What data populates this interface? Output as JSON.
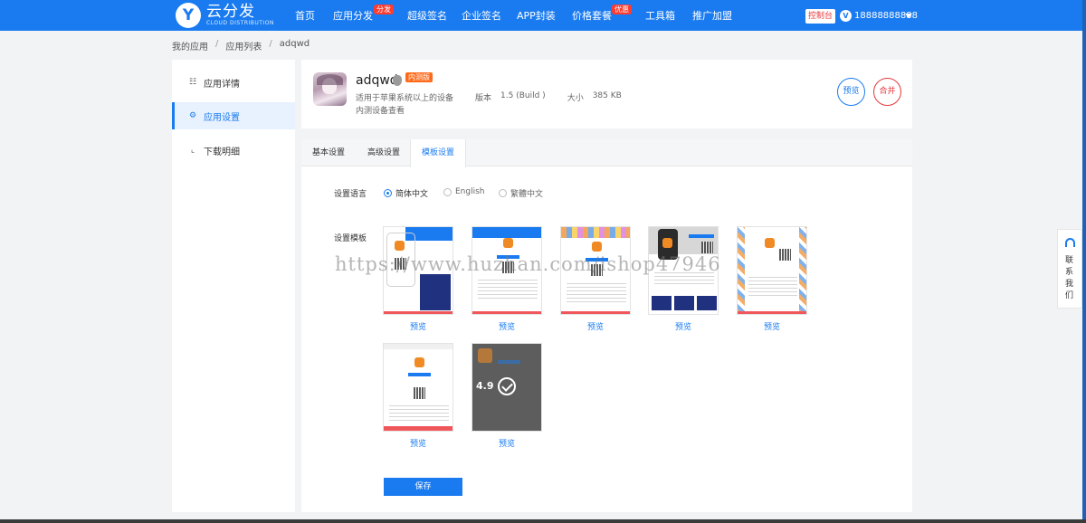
{
  "topbar": {
    "logo_letter": "Y",
    "logo_main": "云分发",
    "logo_sub": "CLOUD DISTRIBUTION",
    "nav": [
      {
        "label": "首页",
        "badge": ""
      },
      {
        "label": "应用分发",
        "badge": "分发"
      },
      {
        "label": "超级签名",
        "badge": ""
      },
      {
        "label": "企业签名",
        "badge": ""
      },
      {
        "label": "APP封装",
        "badge": ""
      },
      {
        "label": "价格套餐",
        "badge": "优惠"
      },
      {
        "label": "工具箱",
        "badge": ""
      },
      {
        "label": "推广加盟",
        "badge": ""
      }
    ],
    "console_label": "控制台",
    "user_avatar_letter": "V",
    "user_phone": "18888888888"
  },
  "breadcrumb": {
    "items": [
      "我的应用",
      "应用列表",
      "adqwd"
    ],
    "separator": "/"
  },
  "sidebar": {
    "items": [
      {
        "label": "应用详情",
        "icon": "grid-icon",
        "active": false
      },
      {
        "label": "应用设置",
        "icon": "gear-icon",
        "active": true
      },
      {
        "label": "下载明细",
        "icon": "chart-icon",
        "active": false
      }
    ]
  },
  "app": {
    "name": "adqwd",
    "tag": "内测版",
    "desc": "适用于苹果系统以上的设备",
    "version_label": "版本",
    "version": "1.5 (Build )",
    "size_label": "大小",
    "size": "385 KB",
    "sub": "内测设备查看",
    "preview_btn": "预览",
    "merge_btn": "合并"
  },
  "tabs": [
    {
      "label": "基本设置",
      "active": false
    },
    {
      "label": "高级设置",
      "active": false
    },
    {
      "label": "模板设置",
      "active": true
    }
  ],
  "settings": {
    "language_label": "设置语言",
    "languages": [
      {
        "label": "简体中文",
        "selected": true
      },
      {
        "label": "English",
        "selected": false
      },
      {
        "label": "繁體中文",
        "selected": false
      }
    ],
    "template_label": "设置模板",
    "template_preview_label": "预览",
    "big_number": "4.9",
    "save_label": "保存"
  },
  "watermark": "https://www.huzhan.com/ishop47946",
  "contact": "联系我们",
  "colors": {
    "primary": "#1a7bf0",
    "danger": "#e4393c",
    "tag_orange": "#ff6a1a"
  }
}
